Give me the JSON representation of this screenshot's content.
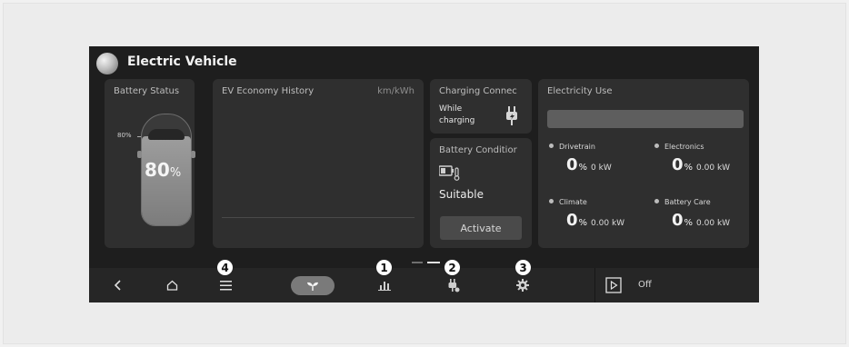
{
  "header": {
    "title": "Electric Vehicle",
    "icon": "globe-icon"
  },
  "battery_status": {
    "title": "Battery Status",
    "level_label": "80%",
    "charge_value": "80",
    "charge_unit": "%",
    "charge_fraction": 0.8
  },
  "ev_economy": {
    "title": "EV Economy History",
    "unit": "km/kWh"
  },
  "charging_connector": {
    "title": "Charging Connec",
    "mode": "While charging",
    "icon": "charger-plug-icon"
  },
  "battery_condition": {
    "title": "Battery Conditior",
    "status": "Suitable",
    "activate_label": "Activate",
    "icon": "battery-thermometer-icon"
  },
  "electricity_use": {
    "title": "Electricity Use",
    "items": [
      {
        "label": "Drivetrain",
        "value": "0",
        "pct": "%",
        "kw": "0 kW"
      },
      {
        "label": "Electronics",
        "value": "0",
        "pct": "%",
        "kw": "0.00 kW"
      },
      {
        "label": "Climate",
        "value": "0",
        "pct": "%",
        "kw": "0.00 kW"
      },
      {
        "label": "Battery Care",
        "value": "0",
        "pct": "%",
        "kw": "0.00 kW"
      }
    ]
  },
  "navbar": {
    "items": [
      "back-icon",
      "home-icon",
      "menu-icon",
      "leaf-icon",
      "bar-chart-icon",
      "charger-icon",
      "gear-icon",
      "play-icon"
    ],
    "media_status": "Off"
  },
  "callouts": [
    "1",
    "2",
    "3",
    "4"
  ],
  "colors": {
    "screen_bg": "#1e1e1e",
    "panel_bg": "#2f2f2f",
    "accent": "#7a7a7a"
  }
}
